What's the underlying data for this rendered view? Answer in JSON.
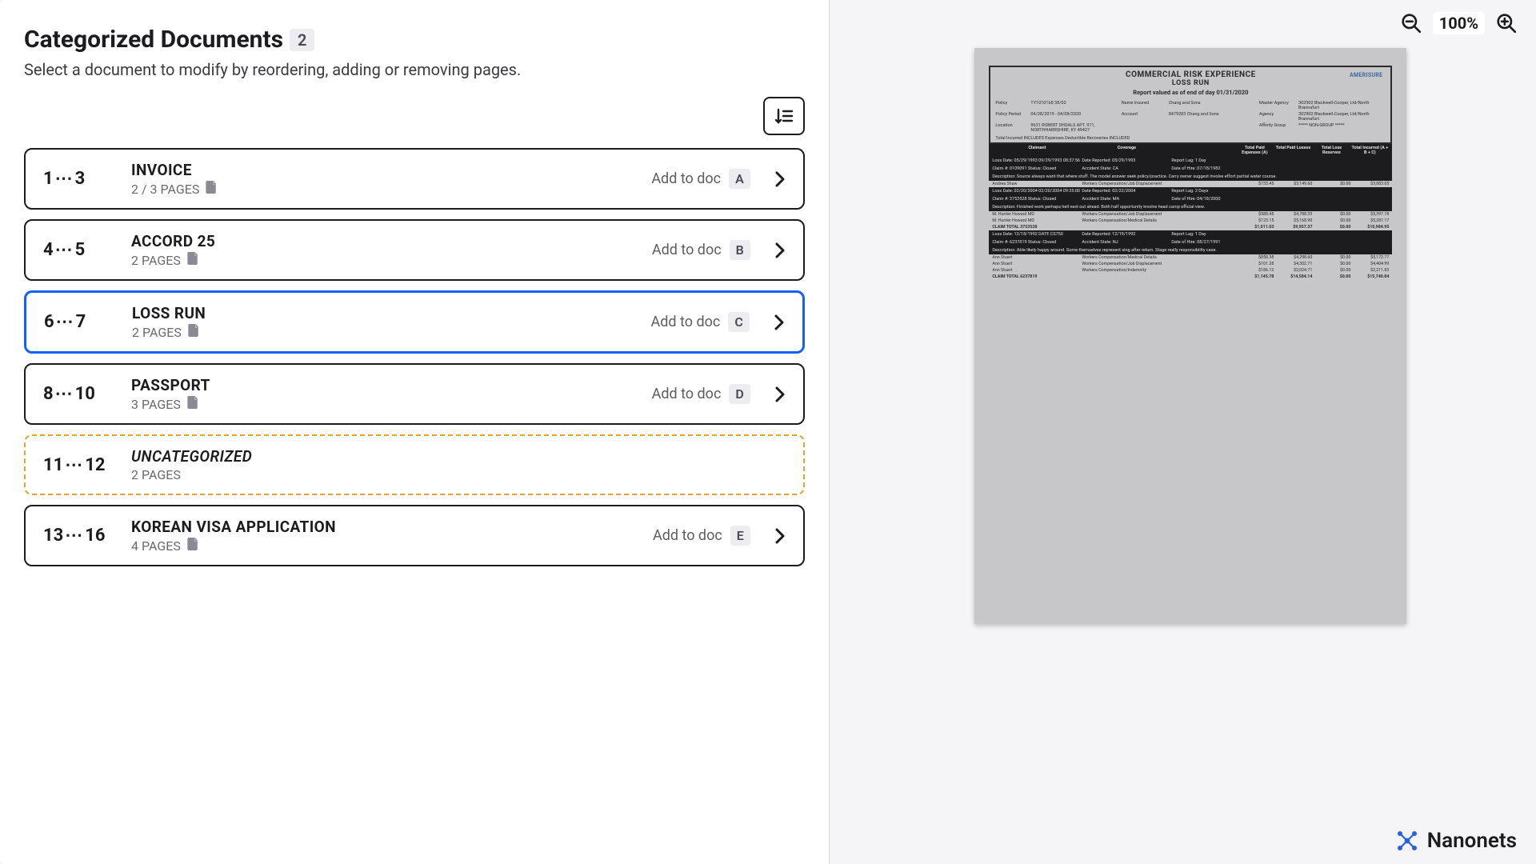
{
  "header": {
    "title": "Categorized Documents",
    "count": "2",
    "subtitle": "Select a document to modify by reordering, adding or removing pages."
  },
  "add_to_doc_label": "Add to doc",
  "documents": [
    {
      "range_from": "1",
      "range_to": "3",
      "name": "INVOICE",
      "pages": "2 / 3 PAGES",
      "key": "A",
      "selected": false,
      "dashed": false,
      "showAdd": true,
      "italic": false,
      "showIcon": true
    },
    {
      "range_from": "4",
      "range_to": "5",
      "name": "ACCORD 25",
      "pages": "2 PAGES",
      "key": "B",
      "selected": false,
      "dashed": false,
      "showAdd": true,
      "italic": false,
      "showIcon": true
    },
    {
      "range_from": "6",
      "range_to": "7",
      "name": "LOSS RUN",
      "pages": "2 PAGES",
      "key": "C",
      "selected": true,
      "dashed": false,
      "showAdd": true,
      "italic": false,
      "showIcon": true
    },
    {
      "range_from": "8",
      "range_to": "10",
      "name": "PASSPORT",
      "pages": "3 PAGES",
      "key": "D",
      "selected": false,
      "dashed": false,
      "showAdd": true,
      "italic": false,
      "showIcon": true
    },
    {
      "range_from": "11",
      "range_to": "12",
      "name": "UNCATEGORIZED",
      "pages": "2 PAGES",
      "key": "",
      "selected": false,
      "dashed": true,
      "showAdd": false,
      "italic": true,
      "showIcon": false
    },
    {
      "range_from": "13",
      "range_to": "16",
      "name": "KOREAN VISA APPLICATION",
      "pages": "4 PAGES",
      "key": "E",
      "selected": false,
      "dashed": false,
      "showAdd": true,
      "italic": false,
      "showIcon": true
    }
  ],
  "zoom": {
    "level": "100%"
  },
  "preview": {
    "title": "COMMERCIAL RISK EXPERIENCE",
    "subtitle": "LOSS RUN",
    "valued": "Report valued as of end of day 01/31/2020",
    "logo": "AMERISURE",
    "info": {
      "policy_lbl": "Policy",
      "policy_val": "TY1010168 38/02",
      "name_lbl": "Name Insured",
      "name_val": "Chang and Sons",
      "master_lbl": "Master Agency",
      "master_val": "302902 Blackwell-Cooper, Ltd/North Brannafurt",
      "period_lbl": "Policy Period",
      "period_val": "04/28/2019 - 04/08/2020",
      "account_lbl": "Account",
      "account_val": "8479283 Chang and Sons",
      "agency_lbl": "Agency",
      "agency_val": "302902 Blackwell-Cooper, Ltd/North Brannafurt",
      "location_lbl": "Location",
      "location_val": "9631 ROBERT SHOALS APT. 911, NORTHHARRSHIRE, KY 49427",
      "affinity_lbl": "Affinity Group",
      "affinity_val": "***** NON-GROUP *****",
      "note": "Total Incurred INCLUDES Expenses     Deductible Recoveries INCLUDED"
    },
    "cols": [
      "Claimant",
      "Coverage",
      "",
      "Total Paid Expenses (A)",
      "Total Paid Losses",
      "Total Loss Reserves",
      "Total Incurred (A + B + C)"
    ],
    "claims": [
      {
        "band": [
          "Loss Date: 05/29/1993  09/29/1993  08:37:56",
          "Date Reported: 05/29/1993",
          "Report Lag: 1 Day",
          "",
          "",
          "",
          ""
        ],
        "band2": [
          "Claim #: 0109091        Status: Closed",
          "Accident State: CA",
          "Date of Hire: 07/18/1982",
          "",
          "",
          "",
          ""
        ],
        "desc": "Description: Source always want that where stuff. The model answer seek policy/practice. Carry owner suggest involve effort partial water course.",
        "rows": [
          [
            "Andrea Shaw",
            "Workers Compensation/Job Displacement",
            "",
            "$733.45",
            "$3,149.60",
            "$0.00",
            "$3,883.05"
          ]
        ]
      },
      {
        "band": [
          "Loss Date: 02/20/2004  02/20/2004  09:35:00",
          "Date Reported: 02/22/2004",
          "Report Lag: 2 Days",
          "",
          "",
          "",
          ""
        ],
        "band2": [
          "Claim #: 3753528        Status: Closed",
          "Accident State: MA",
          "Date of Hire: 04/18/2000",
          "",
          "",
          "",
          ""
        ],
        "desc": "Description: Finished work perhaps hell next out ahead. Both half opportunity involve head camp official view.",
        "rows": [
          [
            "M. Hunter Howard MD",
            "Workers Compensation/Job Displacement",
            "",
            "$588.45",
            "$4,788.33",
            "$0.00",
            "$5,397.78"
          ],
          [
            "M. Hunter Howard MD",
            "Workers Compensation/Medical Details",
            "",
            "$123.15",
            "$5,168.90",
            "$0.00",
            "$5,287.17"
          ]
        ],
        "total": [
          "CLAIM TOTAL  3753528",
          "",
          "",
          "$1,011.03",
          "$9,957.37",
          "$0.00",
          "$10,984.95"
        ]
      },
      {
        "band": [
          "Loss Date: 12/18/1992  DATE  CS750",
          "Date Reported: 12/19/1992",
          "Report Lag: 1 Day",
          "",
          "",
          "",
          ""
        ],
        "band2": [
          "Claim #: 6237819        Status: Closed",
          "Accident State: NJ",
          "Date of Hire: 08/27/1991",
          "",
          "",
          "",
          ""
        ],
        "desc": "Description: Able likely happy around. Some themselves represent sing after return. Stage really responsibility case.",
        "rows": [
          [
            "Ann Stuart",
            "Workers Compensation/Medical Details",
            "",
            "$858.38",
            "$4,298.60",
            "$0.00",
            "$5,172.77"
          ],
          [
            "Ann Stuart",
            "Workers Compensation/Job Displacement",
            "",
            "$101.28",
            "$4,302.71",
            "$0.00",
            "$4,404.99"
          ],
          [
            "Ann Stuart",
            "Workers Compensation/Indemnity",
            "",
            "$186.12",
            "$2,024.71",
            "$0.00",
            "$2,211.83"
          ]
        ],
        "total": [
          "CLAIM TOTAL  6237819",
          "",
          "",
          "$1,145.78",
          "$14,584.14",
          "$0.00",
          "$15,740.84"
        ]
      }
    ]
  },
  "brand": "Nanonets"
}
